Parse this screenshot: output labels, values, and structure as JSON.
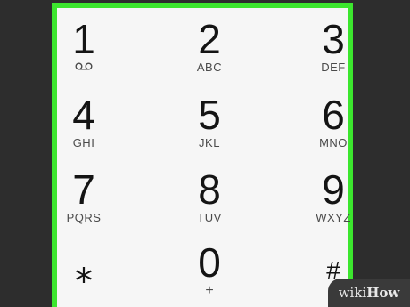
{
  "keypad": {
    "keys": [
      {
        "digit": "1",
        "letters": ""
      },
      {
        "digit": "2",
        "letters": "ABC"
      },
      {
        "digit": "3",
        "letters": "DEF"
      },
      {
        "digit": "4",
        "letters": "GHI"
      },
      {
        "digit": "5",
        "letters": "JKL"
      },
      {
        "digit": "6",
        "letters": "MNO"
      },
      {
        "digit": "7",
        "letters": "PQRS"
      },
      {
        "digit": "8",
        "letters": "TUV"
      },
      {
        "digit": "9",
        "letters": "WXYZ"
      },
      {
        "digit": "⁎",
        "letters": ""
      },
      {
        "digit": "0",
        "letters": "+"
      },
      {
        "digit": "#",
        "letters": ""
      }
    ],
    "icons": {
      "voicemail": "voicemail-icon"
    },
    "colors": {
      "highlight_border": "#3ce62e",
      "keypad_background": "#f6f6f6",
      "page_background": "#2d2d2d"
    }
  },
  "watermark": {
    "prefix": "wiki",
    "suffix": "How"
  }
}
